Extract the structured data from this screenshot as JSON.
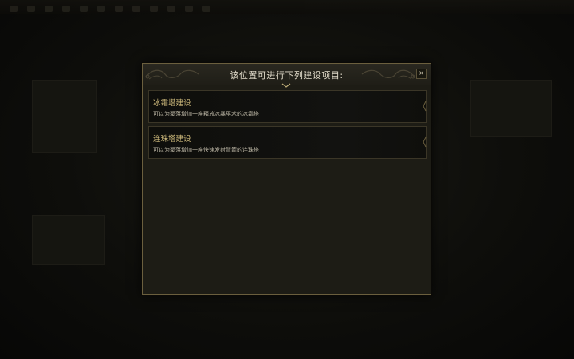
{
  "dialog": {
    "title": "该位置可进行下列建设项目:",
    "close_label": "×"
  },
  "options": [
    {
      "title": "冰霜塔建设",
      "description": "可以为聚落增加一座释放冰暴巫术的冰霜塔"
    },
    {
      "title": "连珠塔建设",
      "description": "可以为聚落增加一座快速发射弩箭的连珠塔"
    }
  ],
  "colors": {
    "accent_gold": "#cbb77a",
    "border_gold": "#6b5f3e",
    "panel_bg": "#1d1c15"
  }
}
